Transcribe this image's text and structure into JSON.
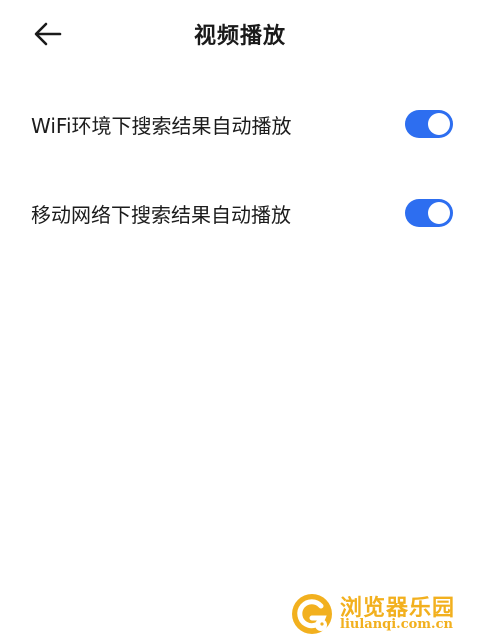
{
  "header": {
    "back_icon": "arrow-left-icon",
    "title": "视频播放"
  },
  "settings": [
    {
      "label": "WiFi环境下搜索结果自动播放",
      "enabled": true
    },
    {
      "label": "移动网络下搜索结果自动播放",
      "enabled": true
    }
  ],
  "colors": {
    "toggle_on": "#2d6ef0",
    "watermark": "#f2b01e"
  },
  "watermark": {
    "title": "浏览器乐园",
    "subtitle": "liulanqi.com.cn"
  }
}
